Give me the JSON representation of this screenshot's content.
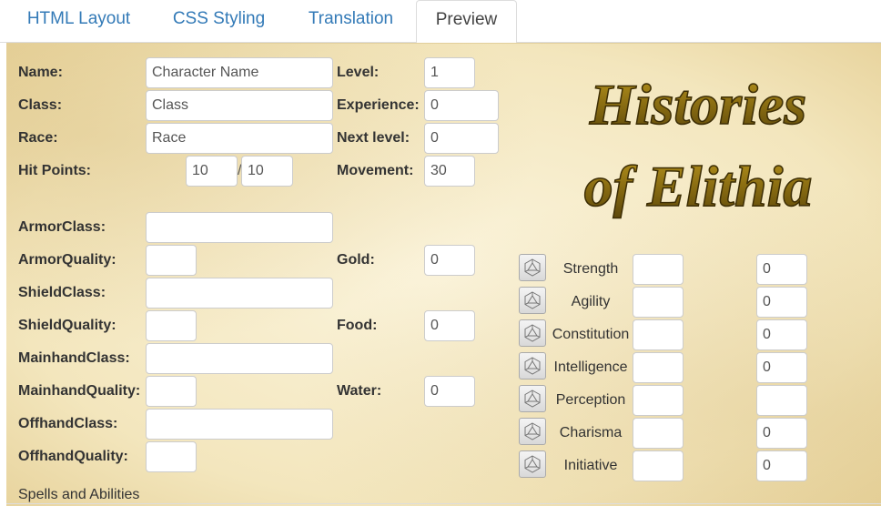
{
  "tabs": [
    "HTML Layout",
    "CSS Styling",
    "Translation",
    "Preview"
  ],
  "labels": {
    "name": "Name:",
    "class": "Class:",
    "race": "Race:",
    "hit_points": "Hit Points:",
    "level": "Level:",
    "experience": "Experience:",
    "next_level": "Next level:",
    "movement": "Movement:",
    "armor_class": "ArmorClass:",
    "armor_quality": "ArmorQuality:",
    "shield_class": "ShieldClass:",
    "shield_quality": "ShieldQuality:",
    "mainhand_class": "MainhandClass:",
    "mainhand_quality": "MainhandQuality:",
    "offhand_class": "OffhandClass:",
    "offhand_quality": "OffhandQuality:",
    "gold": "Gold:",
    "food": "Food:",
    "water": "Water:"
  },
  "placeholders": {
    "name": "Character Name",
    "class": "Class",
    "race": "Race"
  },
  "values": {
    "hp_current": "10",
    "hp_separator": "/",
    "hp_max": "10",
    "level": "1",
    "experience": "0",
    "next_level": "0",
    "movement": "30",
    "armor_class": "",
    "armor_quality": "",
    "shield_class": "",
    "shield_quality": "",
    "mainhand_class": "",
    "mainhand_quality": "",
    "offhand_class": "",
    "offhand_quality": "",
    "gold": "0",
    "food": "0",
    "water": "0"
  },
  "logo": {
    "line1": "Histories",
    "line2": "of Elithia",
    "color": "#8a6d12"
  },
  "stats": [
    {
      "name": "Strength",
      "base": "",
      "mod": "0"
    },
    {
      "name": "Agility",
      "base": "",
      "mod": "0"
    },
    {
      "name": "Constitution",
      "base": "",
      "mod": "0"
    },
    {
      "name": "Intelligence",
      "base": "",
      "mod": "0"
    },
    {
      "name": "Perception",
      "base": "",
      "mod": ""
    },
    {
      "name": "Charisma",
      "base": "",
      "mod": "0"
    },
    {
      "name": "Initiative",
      "base": "",
      "mod": "0"
    }
  ],
  "icons": {
    "roll": "d20-dice-icon"
  },
  "footer": "Spells and Abilities",
  "colors": {
    "link": "#337ab7",
    "parchment": "#f3e6bd",
    "gold": "#8a6d12"
  }
}
